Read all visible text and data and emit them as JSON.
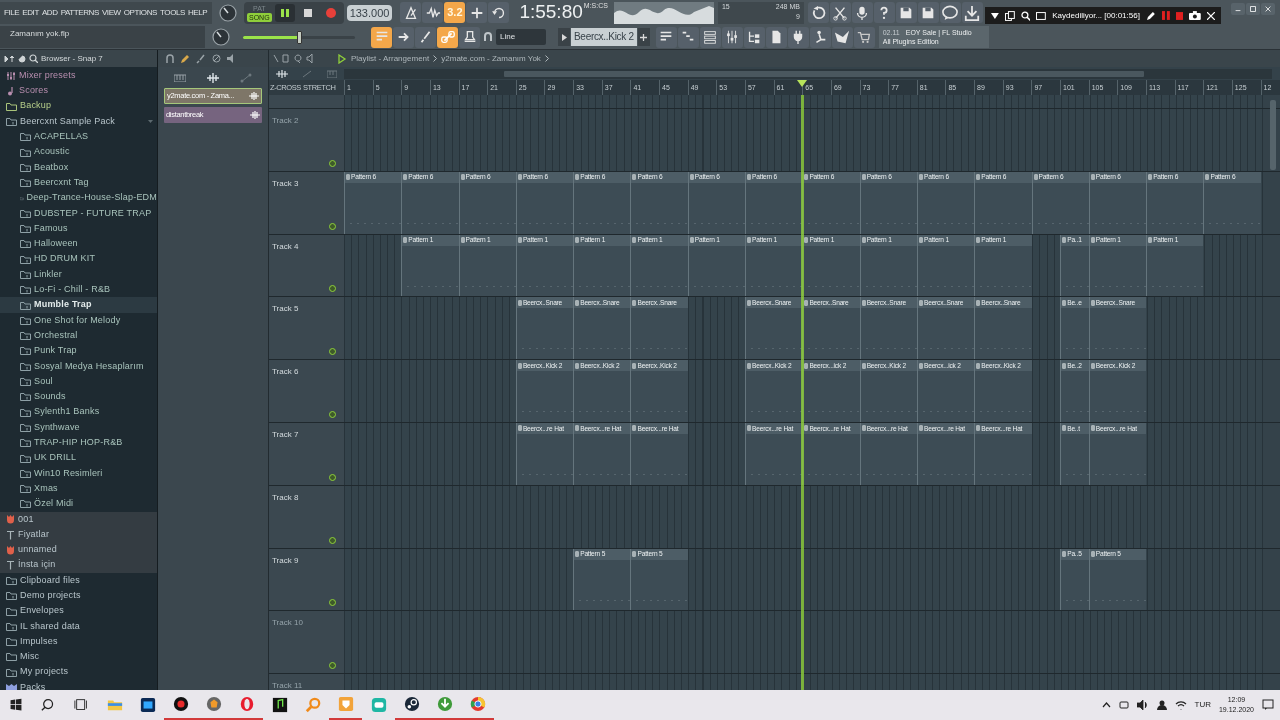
{
  "menu": [
    "FILE",
    "EDIT",
    "ADD",
    "PATTERNS",
    "VIEW",
    "OPTIONS",
    "TOOLS",
    "HELP"
  ],
  "transport": {
    "modes": [
      {
        "label": "PAT",
        "selected": false
      },
      {
        "label": "SONG",
        "selected": true
      }
    ],
    "playing": true,
    "tempo": "133.000"
  },
  "toolbar_top": [
    {
      "on": false
    },
    {
      "on": false
    },
    {
      "on": true,
      "label": "3.2"
    },
    {
      "on": false
    },
    {
      "on": false
    }
  ],
  "clock": {
    "time": "1:55:80",
    "unit": "M:S:CS"
  },
  "monitor": {
    "polyphony": "15",
    "memory": "248 MB",
    "cpu": "9"
  },
  "toolbar_right": [
    {
      "on": false
    },
    {
      "on": false
    },
    {
      "on": false
    },
    {
      "on": false
    },
    {
      "on": false
    },
    {
      "on": false
    },
    {
      "on": false
    },
    {
      "on": false
    }
  ],
  "recorder": {
    "status": "Kaydediliyor... [00:01:56]"
  },
  "hint": "Zamanım yok.flp",
  "master": {
    "level": 0.5
  },
  "toolbar_tools": [
    {
      "on": true
    },
    {
      "on": false
    },
    {
      "on": false
    },
    {
      "on": true
    },
    {
      "on": false
    }
  ],
  "snap": {
    "value": "Line"
  },
  "pattern": {
    "value": "Beercx..Kick 2"
  },
  "toolbar_windows": [
    {
      "on": false
    },
    {
      "on": false
    },
    {
      "on": false
    },
    {
      "on": false
    },
    {
      "on": false
    },
    {
      "on": false
    },
    {
      "on": false
    },
    {
      "on": false
    },
    {
      "on": false
    },
    {
      "on": false
    }
  ],
  "news": {
    "date": "02.11",
    "line1": "EOY Sale | FL Studio",
    "line2": "All Plugins Edition"
  },
  "browser": {
    "title": "Browser - Snap 7",
    "items": [
      {
        "kind": "mixer",
        "label": "Mixer presets",
        "selected": false
      },
      {
        "kind": "score",
        "label": "Scores",
        "selected": false
      },
      {
        "kind": "backup",
        "label": "Backup",
        "selected": false
      },
      {
        "kind": "folder",
        "label": "Beercxnt Sample Pack",
        "selected": false,
        "expanded": true,
        "children": [
          {
            "kind": "folder",
            "label": "ACAPELLAS",
            "selected": false
          },
          {
            "kind": "folder",
            "label": "Acoustic",
            "selected": false
          },
          {
            "kind": "folder",
            "label": "Beatbox",
            "selected": false
          },
          {
            "kind": "folder",
            "label": "Beercxnt Tag",
            "selected": false
          },
          {
            "kind": "folder",
            "label": "Deep-Trance-House-Slap-EDM",
            "selected": false
          },
          {
            "kind": "folder",
            "label": "DUBSTEP - FUTURE TRAP",
            "selected": false
          },
          {
            "kind": "folder",
            "label": "Famous",
            "selected": false
          },
          {
            "kind": "folder",
            "label": "Halloween",
            "selected": false
          },
          {
            "kind": "folder",
            "label": "HD DRUM KIT",
            "selected": false
          },
          {
            "kind": "folder",
            "label": "Linkler",
            "selected": false
          },
          {
            "kind": "folder",
            "label": "Lo-Fi  - Chill - R&B",
            "selected": false
          },
          {
            "kind": "folder",
            "label": "Mumble Trap",
            "selected": true
          },
          {
            "kind": "folder",
            "label": "One Shot for Melody",
            "selected": false
          },
          {
            "kind": "folder",
            "label": "Orchestral",
            "selected": false
          },
          {
            "kind": "folder",
            "label": "Punk Trap",
            "selected": false
          },
          {
            "kind": "folder",
            "label": "Sosyal Medya Hesaplarım",
            "selected": false
          },
          {
            "kind": "folder",
            "label": "Soul",
            "selected": false
          },
          {
            "kind": "folder",
            "label": "Sounds",
            "selected": false
          },
          {
            "kind": "folder",
            "label": "Sylenth1 Banks",
            "selected": false
          },
          {
            "kind": "folder",
            "label": "Synthwave",
            "selected": false
          },
          {
            "kind": "folder",
            "label": "TRAP-HIP HOP-R&B",
            "selected": false
          },
          {
            "kind": "folder",
            "label": "UK DRILL",
            "selected": false
          },
          {
            "kind": "folder",
            "label": "Win10 Resimleri",
            "selected": false
          },
          {
            "kind": "folder",
            "label": "Xmas",
            "selected": false
          },
          {
            "kind": "folder",
            "label": "Özel Midi",
            "selected": false
          }
        ]
      },
      {
        "kind": "plugin",
        "label": "001",
        "selected": false
      },
      {
        "kind": "text",
        "label": "Fiyatlar",
        "selected": false
      },
      {
        "kind": "plugin",
        "label": "unnamed",
        "selected": false
      },
      {
        "kind": "text",
        "label": "İnsta için",
        "selected": false
      },
      {
        "kind": "folder",
        "label": "Clipboard files",
        "selected": false
      },
      {
        "kind": "folder",
        "label": "Demo projects",
        "selected": false
      },
      {
        "kind": "plain",
        "label": "Envelopes",
        "selected": false
      },
      {
        "kind": "folder",
        "label": "IL shared data",
        "selected": false
      },
      {
        "kind": "plain",
        "label": "Impulses",
        "selected": false
      },
      {
        "kind": "plain",
        "label": "Misc",
        "selected": false
      },
      {
        "kind": "folder",
        "label": "My projects",
        "selected": false
      },
      {
        "kind": "packs",
        "label": "Packs",
        "selected": false
      }
    ]
  },
  "channels": [
    {
      "label": "y2mate.com - Zama...",
      "selected": true
    },
    {
      "label": "distantbreak",
      "selected": false
    }
  ],
  "playlist": {
    "title": "Playlist - Arrangement",
    "song": "y2mate.com - Zamanım Yok",
    "z_cross": "Z-CROSS",
    "stretch": "STRETCH",
    "ruler": [
      "1",
      "5",
      "9",
      "13",
      "17",
      "21",
      "25",
      "29",
      "33",
      "37",
      "41",
      "45",
      "49",
      "53",
      "57",
      "61",
      "65",
      "69",
      "73",
      "77",
      "81",
      "85",
      "89",
      "93",
      "97",
      "101",
      "105",
      "109",
      "113",
      "117",
      "121",
      "125",
      "12"
    ],
    "playhead": {
      "level": 0.5
    },
    "tracks": [
      {
        "label": "Track 2",
        "dimmed": true
      },
      {
        "label": "Track 3",
        "dimmed": false,
        "lane": [
          {
            "kind": "clip",
            "label": "Pattern 6"
          },
          {
            "kind": "clip",
            "label": "Pattern 6"
          },
          {
            "kind": "clip",
            "label": "Pattern 6"
          },
          {
            "kind": "clip",
            "label": "Pattern 6"
          },
          {
            "kind": "clip",
            "label": "Pattern 6"
          },
          {
            "kind": "clip",
            "label": "Pattern 6"
          },
          {
            "kind": "clip",
            "label": "Pattern 6"
          },
          {
            "kind": "clip",
            "label": "Pattern 6"
          },
          {
            "kind": "clip",
            "label": "Pattern 6"
          },
          {
            "kind": "clip",
            "label": "Pattern 6"
          },
          {
            "kind": "clip",
            "label": "Pattern 6"
          },
          {
            "kind": "clip",
            "label": "Pattern 6"
          },
          {
            "kind": "clip",
            "label": "Pattern 6"
          },
          {
            "kind": "clip",
            "label": "Pattern 6"
          },
          {
            "kind": "clip",
            "label": "Pattern 6"
          },
          {
            "kind": "clip",
            "label": "Pattern 6"
          }
        ]
      },
      {
        "label": "Track 4",
        "dimmed": false,
        "lane": [
          {
            "kind": "gap"
          },
          {
            "kind": "clip",
            "label": "Pattern 1"
          },
          {
            "kind": "clip",
            "label": "Pattern 1"
          },
          {
            "kind": "clip",
            "label": "Pattern 1"
          },
          {
            "kind": "clip",
            "label": "Pattern 1"
          },
          {
            "kind": "clip",
            "label": "Pattern 1"
          },
          {
            "kind": "clip",
            "label": "Pattern 1"
          },
          {
            "kind": "clip",
            "label": "Pattern 1"
          },
          {
            "kind": "clip",
            "label": "Pattern 1"
          },
          {
            "kind": "clip",
            "label": "Pattern 1"
          },
          {
            "kind": "clip",
            "label": "Pattern 1"
          },
          {
            "kind": "clip",
            "label": "Pattern 1"
          },
          {
            "kind": "half_gap"
          },
          {
            "kind": "half_clip",
            "label": "Pa..1"
          },
          {
            "kind": "clip",
            "label": "Pattern 1"
          },
          {
            "kind": "clip",
            "label": "Pattern 1"
          }
        ]
      },
      {
        "label": "Track 5",
        "dimmed": false,
        "lane": [
          {
            "kind": "gap"
          },
          {
            "kind": "gap"
          },
          {
            "kind": "gap"
          },
          {
            "kind": "clip",
            "label": "Beercx..Snare"
          },
          {
            "kind": "clip",
            "label": "Beercx..Snare"
          },
          {
            "kind": "clip",
            "label": "Beercx..Snare"
          },
          {
            "kind": "gap"
          },
          {
            "kind": "clip",
            "label": "Beercx..Snare"
          },
          {
            "kind": "clip",
            "label": "Beercx..Snare"
          },
          {
            "kind": "clip",
            "label": "Beercx..Snare"
          },
          {
            "kind": "clip",
            "label": "Beercx..Snare"
          },
          {
            "kind": "clip",
            "label": "Beercx..Snare"
          },
          {
            "kind": "half_gap"
          },
          {
            "kind": "half_clip",
            "label": "Be..e"
          },
          {
            "kind": "clip",
            "label": "Beercx..Snare"
          }
        ]
      },
      {
        "label": "Track 6",
        "dimmed": false,
        "lane": [
          {
            "kind": "gap"
          },
          {
            "kind": "gap"
          },
          {
            "kind": "gap"
          },
          {
            "kind": "clip",
            "label": "Beercx..Kick 2"
          },
          {
            "kind": "clip",
            "label": "Beercx..Kick 2"
          },
          {
            "kind": "clip",
            "label": "Beercx..Kick 2"
          },
          {
            "kind": "gap"
          },
          {
            "kind": "clip",
            "label": "Beercx..Kick 2"
          },
          {
            "kind": "clip",
            "label": "Beercx...ick 2"
          },
          {
            "kind": "clip",
            "label": "Beercx..Kick 2"
          },
          {
            "kind": "clip",
            "label": "Beercx...ick 2"
          },
          {
            "kind": "clip",
            "label": "Beercx..Kick 2"
          },
          {
            "kind": "half_gap"
          },
          {
            "kind": "half_clip",
            "label": "Be..2"
          },
          {
            "kind": "clip",
            "label": "Beercx..Kick 2"
          }
        ]
      },
      {
        "label": "Track 7",
        "dimmed": false,
        "lane": [
          {
            "kind": "gap"
          },
          {
            "kind": "gap"
          },
          {
            "kind": "gap"
          },
          {
            "kind": "clip",
            "label": "Beercx...re Hat"
          },
          {
            "kind": "clip",
            "label": "Beercx...re Hat"
          },
          {
            "kind": "clip",
            "label": "Beercx...re Hat"
          },
          {
            "kind": "gap"
          },
          {
            "kind": "clip",
            "label": "Beercx...re Hat"
          },
          {
            "kind": "clip",
            "label": "Beercx...re Hat"
          },
          {
            "kind": "clip",
            "label": "Beercx...re Hat"
          },
          {
            "kind": "clip",
            "label": "Beercx...re Hat"
          },
          {
            "kind": "clip",
            "label": "Beercx...re Hat"
          },
          {
            "kind": "half_gap"
          },
          {
            "kind": "half_clip",
            "label": "Be..t"
          },
          {
            "kind": "clip",
            "label": "Beercx...re Hat"
          }
        ]
      },
      {
        "label": "Track 8",
        "dimmed": false
      },
      {
        "label": "Track 9",
        "dimmed": false,
        "lane": [
          {
            "kind": "gap"
          },
          {
            "kind": "gap"
          },
          {
            "kind": "gap"
          },
          {
            "kind": "gap"
          },
          {
            "kind": "clip",
            "label": "Pattern 5"
          },
          {
            "kind": "clip",
            "label": "Pattern 5"
          },
          {
            "kind": "gap"
          },
          {
            "kind": "gap"
          },
          {
            "kind": "gap"
          },
          {
            "kind": "gap"
          },
          {
            "kind": "gap"
          },
          {
            "kind": "gap"
          },
          {
            "kind": "half_gap"
          },
          {
            "kind": "half_clip",
            "label": "Pa..5"
          },
          {
            "kind": "clip",
            "label": "Pattern 5"
          }
        ]
      },
      {
        "label": "Track 10",
        "dimmed": true
      },
      {
        "label": "Track 11",
        "dimmed": true
      }
    ]
  },
  "taskbar": {
    "apps": [
      {
        "running": false
      },
      {
        "running": false
      },
      {
        "running": false
      },
      {
        "running": false
      },
      {
        "running": true
      },
      {
        "running": true
      },
      {
        "running": true
      },
      {
        "running": false
      },
      {
        "running": false
      },
      {
        "running": true
      },
      {
        "running": false
      },
      {
        "running": true
      },
      {
        "running": true
      },
      {
        "running": true
      }
    ],
    "language": "TUR",
    "time": "12:09",
    "date": "19.12.2020"
  }
}
